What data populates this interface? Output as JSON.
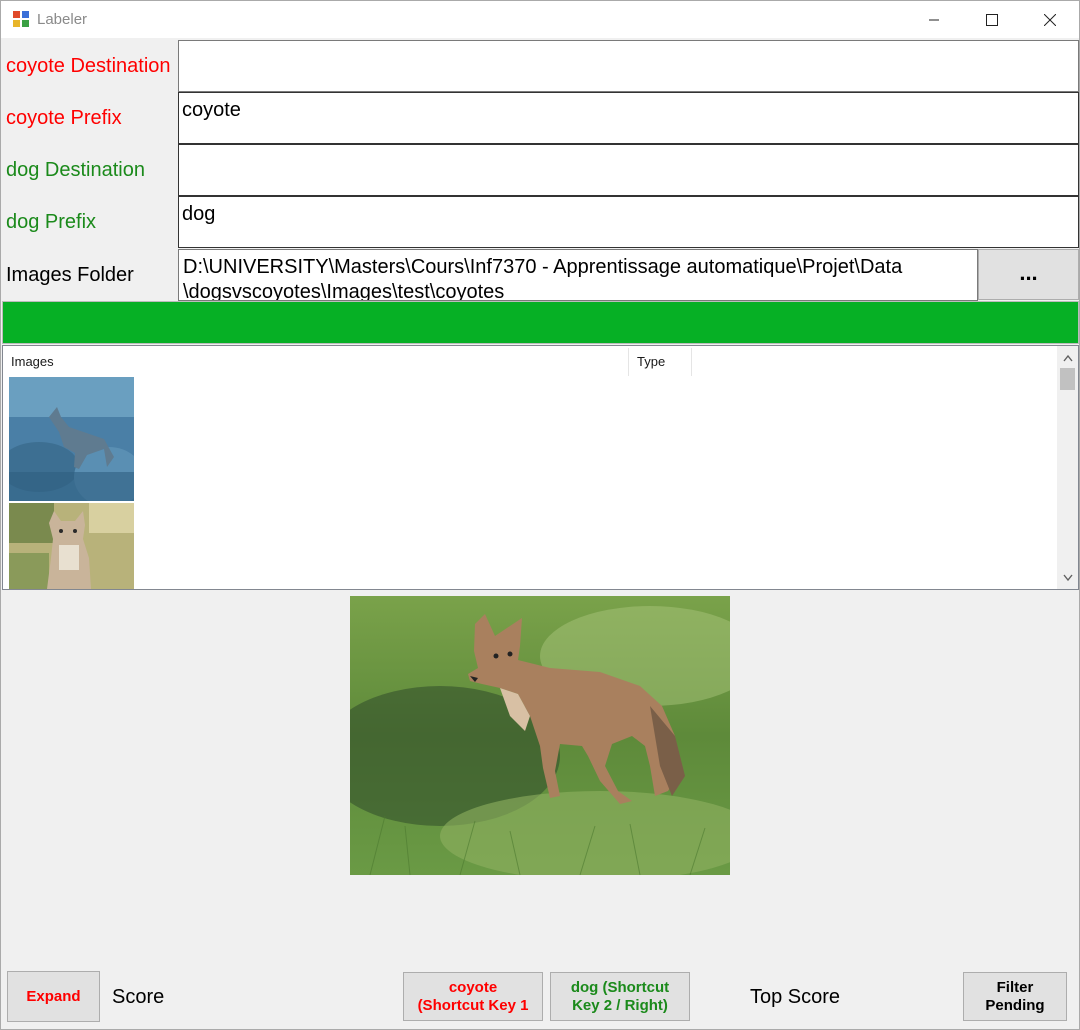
{
  "window": {
    "title": "Labeler"
  },
  "fields": {
    "coyote_destination": {
      "label": "coyote Destination",
      "value": ""
    },
    "coyote_prefix": {
      "label": "coyote Prefix",
      "value": "coyote"
    },
    "dog_destination": {
      "label": "dog Destination",
      "value": ""
    },
    "dog_prefix": {
      "label": "dog Prefix",
      "value": "dog"
    },
    "images_folder": {
      "label": "Images Folder",
      "line1": "D:\\UNIVERSITY\\Masters\\Cours\\Inf7370 - Apprentissage automatique\\Projet\\Data",
      "line2": "\\dogsvscoyotes\\Images\\test\\coyotes"
    },
    "browse_label": "..."
  },
  "progress": {
    "fraction": 1.0
  },
  "list": {
    "columns": [
      "Images",
      "Type"
    ],
    "rows": [
      {
        "image": "coyote-thumbnail-1",
        "type": ""
      },
      {
        "image": "coyote-thumbnail-2",
        "type": ""
      }
    ]
  },
  "preview": {
    "image": "coyote-preview"
  },
  "bottom": {
    "expand_label": "Expand",
    "score_label": "Score",
    "coyote_button": {
      "line1": "coyote",
      "line2": "(Shortcut Key 1"
    },
    "dog_button": {
      "line1": "dog (Shortcut",
      "line2": "Key 2 / Right)"
    },
    "top_score_label": "Top Score",
    "filter_button": {
      "line1": "Filter",
      "line2": "Pending"
    }
  },
  "colors": {
    "coyote": "#ff0000",
    "dog": "#1b8a1b",
    "progress": "#06b025"
  }
}
